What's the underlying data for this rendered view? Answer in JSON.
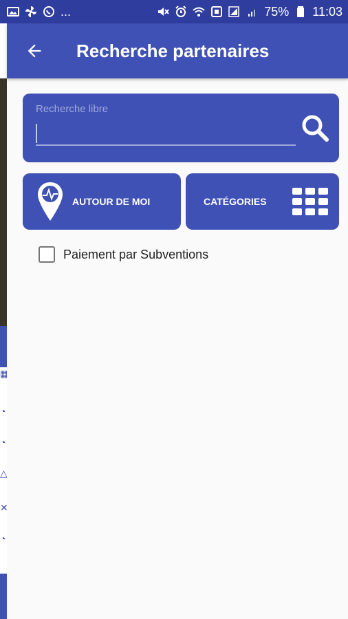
{
  "status_bar": {
    "overflow": "...",
    "battery": "75%",
    "time": "11:03",
    "left_icons": [
      "image-icon",
      "pinwheel-icon",
      "whatsapp-icon"
    ],
    "right_icons": [
      "mute-icon",
      "alarm-icon",
      "wifi-icon",
      "nfc-icon",
      "signal-icon",
      "battery-icon"
    ]
  },
  "app_bar": {
    "title": "Recherche partenaires",
    "back_icon": "arrow-left-icon"
  },
  "search": {
    "placeholder": "Recherche libre",
    "value": "",
    "icon": "search-icon"
  },
  "actions": {
    "around_me": "AUTOUR DE MOI",
    "around_me_icon": "location-pin-icon",
    "categories": "CATÉGORIES",
    "categories_icon": "grid-icon"
  },
  "filters": {
    "subsidy_payment": {
      "label": "Paiement par Subventions",
      "checked": false
    }
  },
  "colors": {
    "primary": "#3f51b5",
    "status_bar": "#2f3d9e",
    "background": "#fafafa",
    "hint": "#9fa8da"
  }
}
